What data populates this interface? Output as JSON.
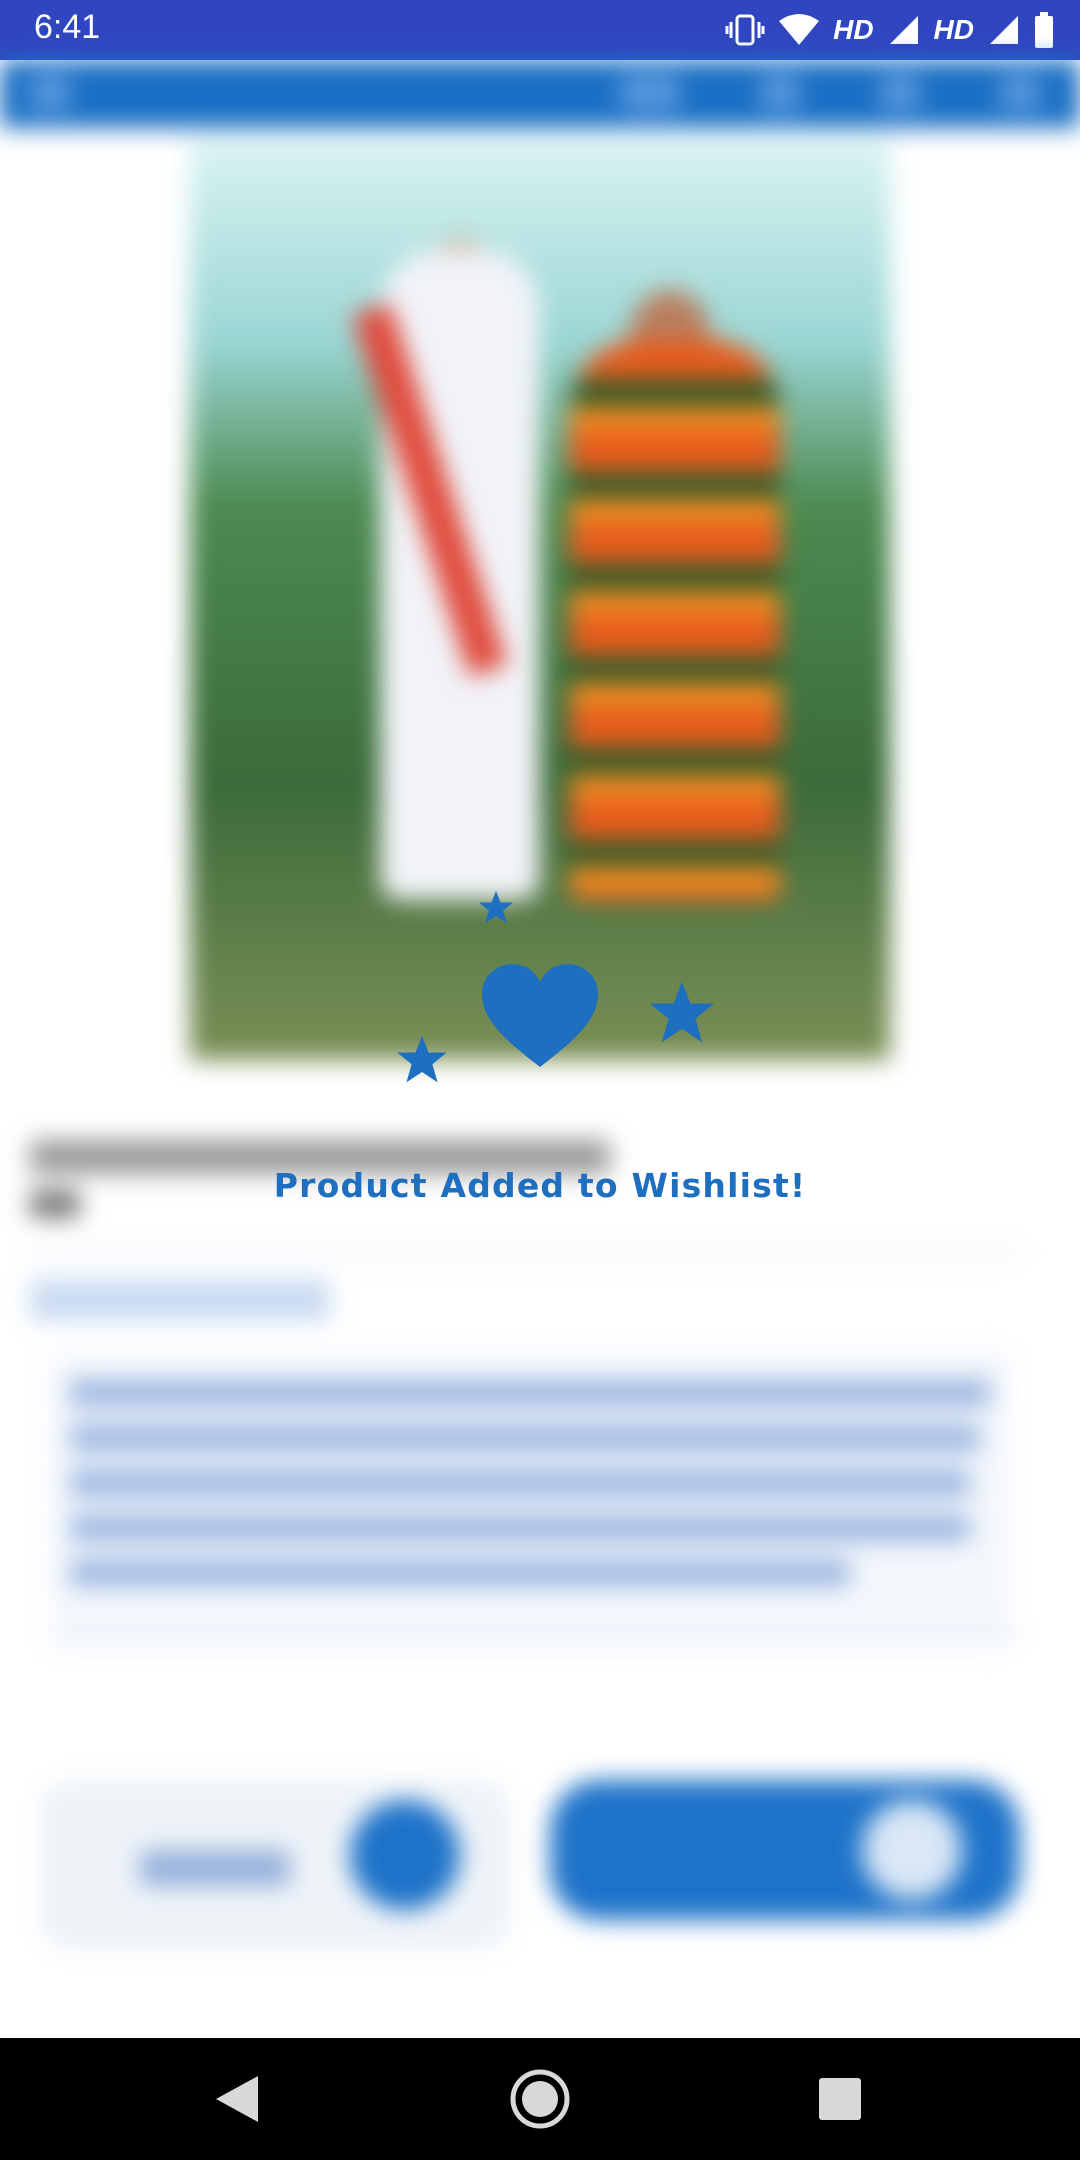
{
  "status_bar": {
    "time": "6:41",
    "network_label_1": "HD",
    "network_label_2": "HD",
    "icons": [
      "vibrate-icon",
      "wifi-icon",
      "signal-icon",
      "signal-icon",
      "battery-icon"
    ]
  },
  "overlay": {
    "message": "Product Added to Wishlist!",
    "accent_color": "#1e6fbf",
    "icons": [
      "heart-icon",
      "star-icon"
    ]
  },
  "nav_bar": {
    "icons": [
      "back-icon",
      "home-icon",
      "recents-icon"
    ]
  },
  "colors": {
    "status_bar": "#3046c0",
    "app_bar": "#1a6fc4",
    "accent": "#1e73c9"
  }
}
